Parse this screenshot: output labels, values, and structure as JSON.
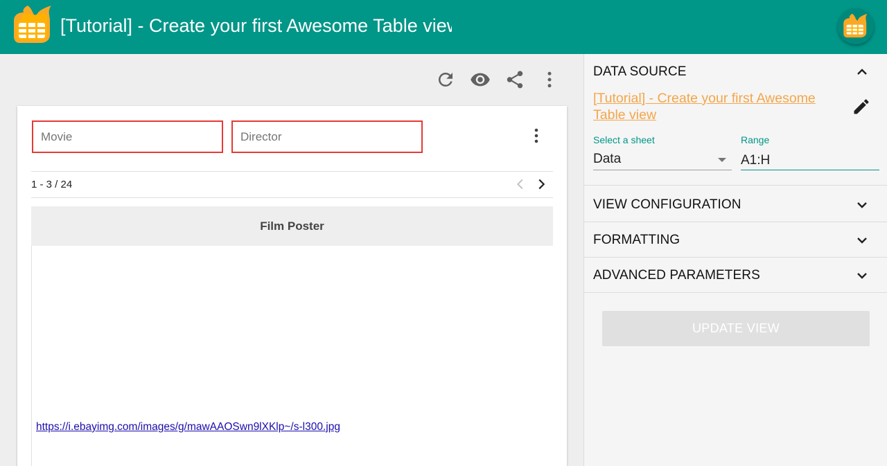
{
  "header": {
    "title": "[Tutorial] - Create your first Awesome Table view",
    "brand_color": "#009688",
    "logo_icon": "awesome-table-logo-icon",
    "avatar_icon": "awesome-table-logo-icon"
  },
  "toolbar": {
    "icons": [
      "refresh-icon",
      "eye-icon",
      "share-icon",
      "more-vert-icon"
    ]
  },
  "view": {
    "filters": [
      {
        "placeholder": "Movie",
        "value": ""
      },
      {
        "placeholder": "Director",
        "value": ""
      }
    ],
    "pagination": {
      "text": "1 - 3 / 24"
    },
    "columns": [
      "Film Poster"
    ],
    "rows": [
      {
        "film_poster": "https://i.ebayimg.com/images/g/mawAAOSwn9lXKlp~/s-l300.jpg"
      }
    ]
  },
  "sidebar": {
    "data_source": {
      "title": "DATA SOURCE",
      "link": "[Tutorial] - Create your first Awesome Table view",
      "sheet_label": "Select a sheet",
      "sheet_value": "Data",
      "range_label": "Range",
      "range_value": "A1:H"
    },
    "sections": [
      "VIEW CONFIGURATION",
      "FORMATTING",
      "ADVANCED PARAMETERS"
    ],
    "update_button": "UPDATE VIEW"
  }
}
